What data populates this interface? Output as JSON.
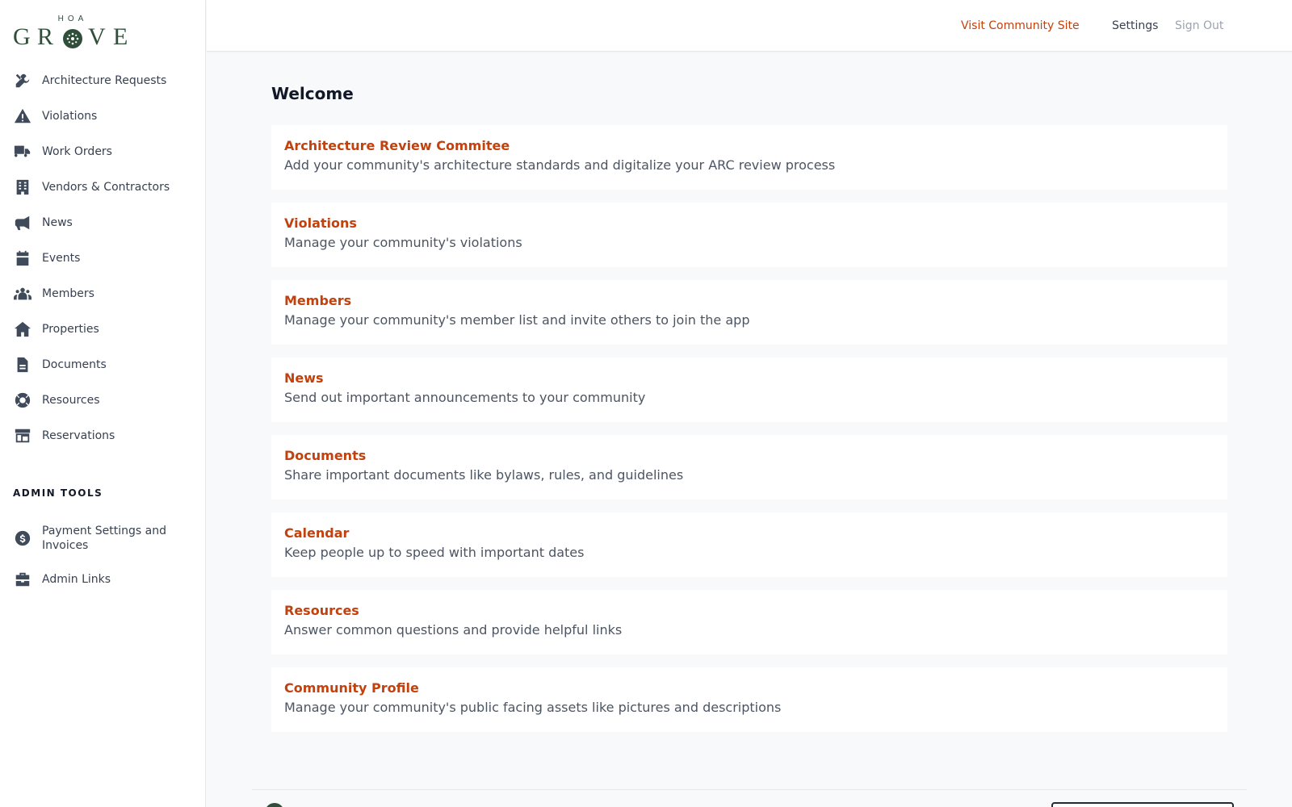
{
  "brand": {
    "top": "HOA",
    "name": "GROVE"
  },
  "sidebar": {
    "items": [
      {
        "label": "Architecture Requests",
        "icon": "tools-icon"
      },
      {
        "label": "Violations",
        "icon": "warning-icon"
      },
      {
        "label": "Work Orders",
        "icon": "truck-icon"
      },
      {
        "label": "Vendors & Contractors",
        "icon": "building-icon"
      },
      {
        "label": "News",
        "icon": "megaphone-icon"
      },
      {
        "label": "Events",
        "icon": "calendar-icon"
      },
      {
        "label": "Members",
        "icon": "users-icon"
      },
      {
        "label": "Properties",
        "icon": "home-icon"
      },
      {
        "label": "Documents",
        "icon": "document-icon"
      },
      {
        "label": "Resources",
        "icon": "lifering-icon"
      },
      {
        "label": "Reservations",
        "icon": "store-icon"
      }
    ],
    "admin_heading": "ADMIN TOOLS",
    "admin_items": [
      {
        "label": "Payment Settings and Invoices",
        "icon": "dollar-icon"
      },
      {
        "label": "Admin Links",
        "icon": "briefcase-icon"
      }
    ]
  },
  "topbar": {
    "visit": "Visit Community Site",
    "settings": "Settings",
    "signout": "Sign Out"
  },
  "main": {
    "title": "Welcome",
    "cards": [
      {
        "title": "Architecture Review Commitee",
        "desc": "Add your community's architecture standards and digitalize your ARC review process"
      },
      {
        "title": "Violations",
        "desc": "Manage your community's violations"
      },
      {
        "title": "Members",
        "desc": "Manage your community's member list and invite others to join the app"
      },
      {
        "title": "News",
        "desc": "Send out important announcements to your community"
      },
      {
        "title": "Documents",
        "desc": "Share important documents like bylaws, rules, and guidelines"
      },
      {
        "title": "Calendar",
        "desc": "Keep people up to speed with important dates"
      },
      {
        "title": "Resources",
        "desc": "Answer common questions and provide helpful links"
      },
      {
        "title": "Community Profile",
        "desc": "Manage your community's public facing assets like pictures and descriptions"
      }
    ]
  },
  "colors": {
    "accent": "#c2410c",
    "brand": "#2f4f3a",
    "text": "#374151"
  }
}
